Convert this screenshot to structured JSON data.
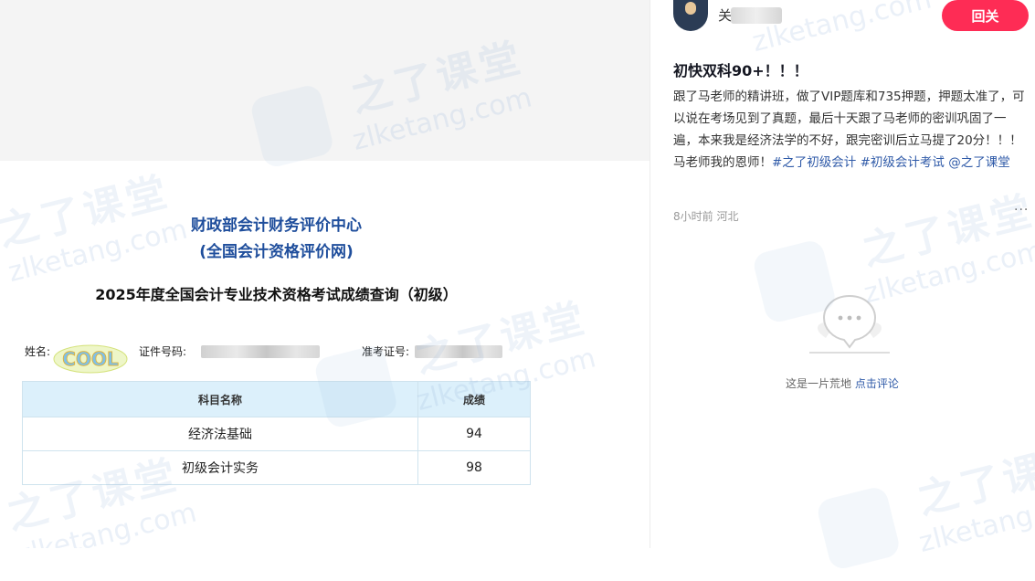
{
  "document": {
    "title_line1": "财政部会计财务评价中心",
    "title_line2": "(全国会计资格评价网)",
    "heading": "2025年度全国会计专业技术资格考试成绩查询（初级）",
    "name_label": "姓名:",
    "id_label": "证件号码:",
    "ticket_label": "准考证号:",
    "sticker_text": "COOL",
    "table": {
      "headers": [
        "科目名称",
        "成绩"
      ],
      "rows": [
        [
          "经济法基础",
          "94"
        ],
        [
          "初级会计实务",
          "98"
        ]
      ]
    }
  },
  "watermark": {
    "zh": "之了课堂",
    "url": "zlketang.com"
  },
  "post": {
    "username": "关",
    "follow_label": "回关",
    "title": "初快双科90+！！！",
    "body": "跟了马老师的精讲班，做了VIP题库和735押题，押题太准了，可以说在考场见到了真题，最后十天跟了马老师的密训巩固了一遍，本来我是经济法学的不好，跟完密训后立马提了20分！！！ 马老师我的恩师！",
    "tags": [
      "#之了初级会计",
      "#初级会计考试",
      "@之了课堂"
    ],
    "time": "8小时前",
    "location": "河北",
    "more_label": "···"
  },
  "comments": {
    "empty_text": "这是一片荒地",
    "comment_link": "点击评论"
  },
  "colors": {
    "accent": "#fe2c55",
    "link": "#2f5aa8",
    "doc_blue": "#1f4e9c",
    "table_header": "#dcf0fb"
  }
}
